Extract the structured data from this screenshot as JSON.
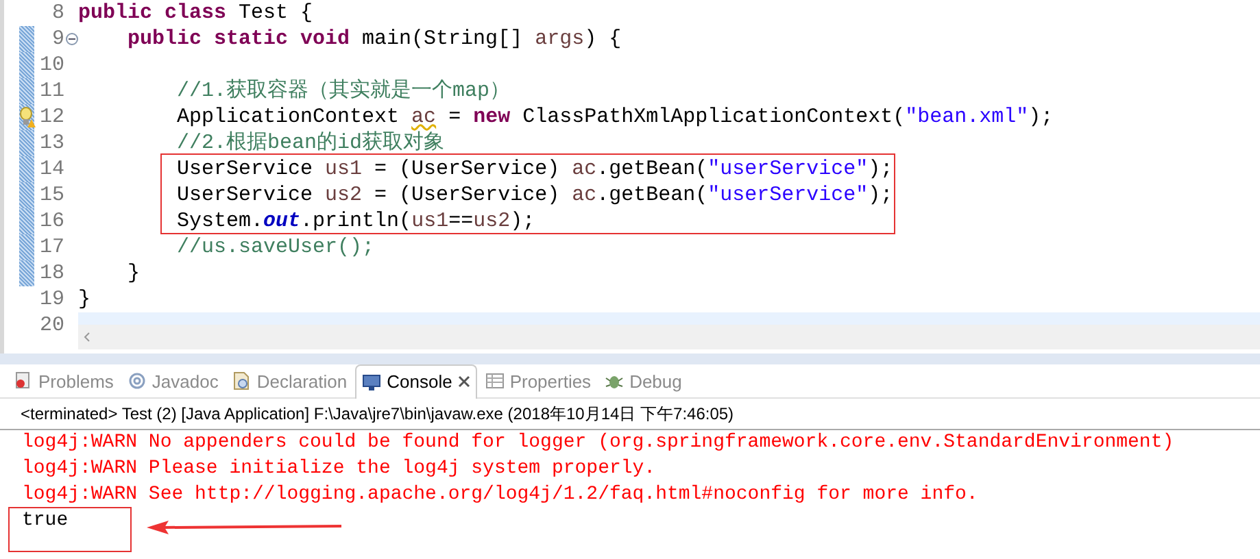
{
  "editor": {
    "lines": [
      {
        "number": "8",
        "changed": false,
        "current": false,
        "fold": false,
        "warning": false,
        "tokens": [
          {
            "text": "public class ",
            "kind": "keyword"
          },
          {
            "text": "Test {",
            "kind": "plain"
          }
        ]
      },
      {
        "number": "9",
        "changed": true,
        "current": false,
        "fold": true,
        "warning": false,
        "tokens": [
          {
            "text": "    public static void ",
            "kind": "keyword"
          },
          {
            "text": "main(String[] ",
            "kind": "plain"
          },
          {
            "text": "args",
            "kind": "param"
          },
          {
            "text": ") {",
            "kind": "plain"
          }
        ]
      },
      {
        "number": "10",
        "changed": true,
        "current": false,
        "fold": false,
        "warning": false
      },
      {
        "number": "11",
        "changed": true,
        "current": false,
        "fold": false,
        "warning": false,
        "tokens": [
          {
            "text": "        //1.获取容器（其实就是一个map）",
            "kind": "comment"
          }
        ]
      },
      {
        "number": "12",
        "changed": true,
        "current": false,
        "fold": false,
        "warning": true,
        "tokens": [
          {
            "text": "        ApplicationContext ",
            "kind": "plain"
          },
          {
            "text": "ac",
            "kind": "unused"
          },
          {
            "text": " = ",
            "kind": "plain"
          },
          {
            "text": "new ",
            "kind": "keyword"
          },
          {
            "text": "ClassPathXmlApplicationContext(",
            "kind": "plain"
          },
          {
            "text": "\"bean.xml\"",
            "kind": "string"
          },
          {
            "text": ");",
            "kind": "plain"
          }
        ]
      },
      {
        "number": "13",
        "changed": true,
        "current": false,
        "fold": false,
        "warning": false,
        "tokens": [
          {
            "text": "        //2.根据bean的id获取对象",
            "kind": "comment"
          }
        ]
      },
      {
        "number": "14",
        "changed": true,
        "current": false,
        "fold": false,
        "warning": false,
        "tokens": [
          {
            "text": "        UserService ",
            "kind": "plain"
          },
          {
            "text": "us1",
            "kind": "param"
          },
          {
            "text": " = (UserService) ",
            "kind": "plain"
          },
          {
            "text": "ac",
            "kind": "param"
          },
          {
            "text": ".getBean(",
            "kind": "plain"
          },
          {
            "text": "\"userService\"",
            "kind": "string"
          },
          {
            "text": ");",
            "kind": "plain"
          }
        ]
      },
      {
        "number": "15",
        "changed": true,
        "current": false,
        "fold": false,
        "warning": false,
        "tokens": [
          {
            "text": "        UserService ",
            "kind": "plain"
          },
          {
            "text": "us2",
            "kind": "param"
          },
          {
            "text": " = (UserService) ",
            "kind": "plain"
          },
          {
            "text": "ac",
            "kind": "param"
          },
          {
            "text": ".getBean(",
            "kind": "plain"
          },
          {
            "text": "\"userService\"",
            "kind": "string"
          },
          {
            "text": ");",
            "kind": "plain"
          }
        ]
      },
      {
        "number": "16",
        "changed": true,
        "current": false,
        "fold": false,
        "warning": false,
        "tokens": [
          {
            "text": "        System.",
            "kind": "plain"
          },
          {
            "text": "out",
            "kind": "static"
          },
          {
            "text": ".println(",
            "kind": "plain"
          },
          {
            "text": "us1",
            "kind": "param"
          },
          {
            "text": "==",
            "kind": "plain"
          },
          {
            "text": "us2",
            "kind": "param"
          },
          {
            "text": ");",
            "kind": "plain"
          }
        ]
      },
      {
        "number": "17",
        "changed": true,
        "current": false,
        "fold": false,
        "warning": false,
        "tokens": [
          {
            "text": "        //us.saveUser();",
            "kind": "comment"
          }
        ]
      },
      {
        "number": "18",
        "changed": true,
        "current": false,
        "fold": false,
        "warning": false,
        "tokens": [
          {
            "text": "    }",
            "kind": "plain"
          }
        ]
      },
      {
        "number": "19",
        "changed": false,
        "current": false,
        "fold": false,
        "warning": false,
        "tokens": [
          {
            "text": "}",
            "kind": "plain"
          }
        ]
      },
      {
        "number": "20",
        "changed": false,
        "current": true,
        "fold": false,
        "warning": false
      }
    ]
  },
  "console": {
    "tabs": [
      {
        "label": "Problems",
        "selected": false,
        "closable": false
      },
      {
        "label": "Javadoc",
        "selected": false,
        "closable": false
      },
      {
        "label": "Declaration",
        "selected": false,
        "closable": false
      },
      {
        "label": "Console",
        "selected": true,
        "closable": true
      },
      {
        "label": "Properties",
        "selected": false,
        "closable": false
      },
      {
        "label": "Debug",
        "selected": false,
        "closable": false
      }
    ],
    "status": "<terminated> Test (2) [Java Application] F:\\Java\\jre7\\bin\\javaw.exe (2018年10月14日 下午7:46:05)",
    "output": [
      {
        "text": "log4j:WARN No appenders could be found for logger (org.springframework.core.env.StandardEnvironment)",
        "kind": "error"
      },
      {
        "text": "log4j:WARN Please initialize the log4j system properly.",
        "kind": "error"
      },
      {
        "text": "log4j:WARN See http://logging.apache.org/log4j/1.2/faq.html#noconfig for more info.",
        "kind": "error"
      },
      {
        "text": "true",
        "kind": "out"
      }
    ]
  }
}
